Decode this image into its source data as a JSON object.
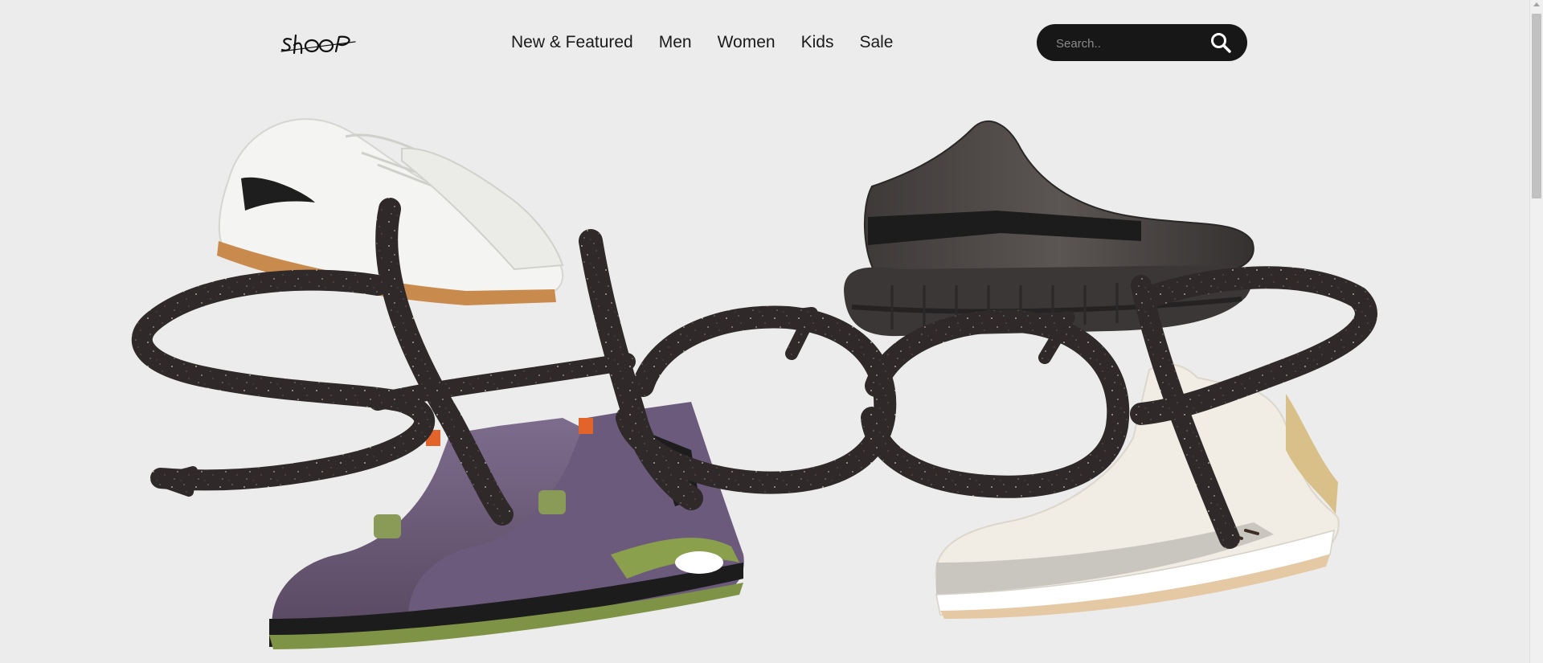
{
  "brand": {
    "logo_text": "SHOOP",
    "hero_wordmark": "SHOOP"
  },
  "nav": {
    "items": [
      {
        "label": "New & Featured"
      },
      {
        "label": "Men"
      },
      {
        "label": "Women"
      },
      {
        "label": "Kids"
      },
      {
        "label": "Sale"
      }
    ]
  },
  "search": {
    "placeholder": "Search..",
    "value": "",
    "icon": "search-icon"
  },
  "hero": {
    "products": [
      {
        "name": "white-low-top-sneaker",
        "color": "#f4f4f2"
      },
      {
        "name": "dark-knit-runner",
        "color": "#3a3736"
      },
      {
        "name": "purple-suede-high-top",
        "color": "#6b5a7c"
      },
      {
        "name": "cream-leather-high-top",
        "color": "#f1ede4"
      }
    ]
  },
  "colors": {
    "background": "#ececec",
    "search_bg": "#171717",
    "text": "#1a1a1a",
    "wordmark": "#2f2a29"
  }
}
